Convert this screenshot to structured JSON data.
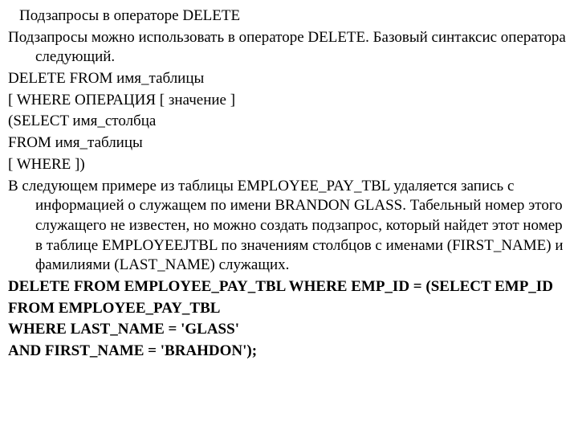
{
  "title": "Подзапросы в операторе DELETE",
  "lines": {
    "p1": "Подзапросы можно использовать в операторе DELETE. Базовый синтаксис оператора следующий.",
    "p2": "DELETE FROM имя_таблицы",
    "p3": "[ WHERE ОПЕРАЦИЯ [ значение ]",
    "p4": "(SELECT имя_столбца",
    "p5": "FROM имя_таблицы",
    "p6": "[ WHERE ])",
    "p7": "В следующем примере из таблицы EMPLOYEE_PAY_TBL удаляется запись с информацией о служащем по имени BRANDON GLASS. Табельный номер этого служащего не известен, но можно создать подзапрос, который найдет этот номер в таблице EMPLOYEEJTBL по значениям столбцов с именами (FIRST_NAME) и фамилиями (LAST_NAME) служащих.",
    "p8": "DELETE FROM EMPLOYEE_PAY_TBL WHERE EMP_ID = (SELECT EMP_ID",
    "p9": "FROM EMPLOYEE_PAY_TBL",
    "p10": "WHERE LAST_NAME = 'GLASS'",
    "p11": "AND FIRST_NAME = 'BRAHDON');"
  }
}
